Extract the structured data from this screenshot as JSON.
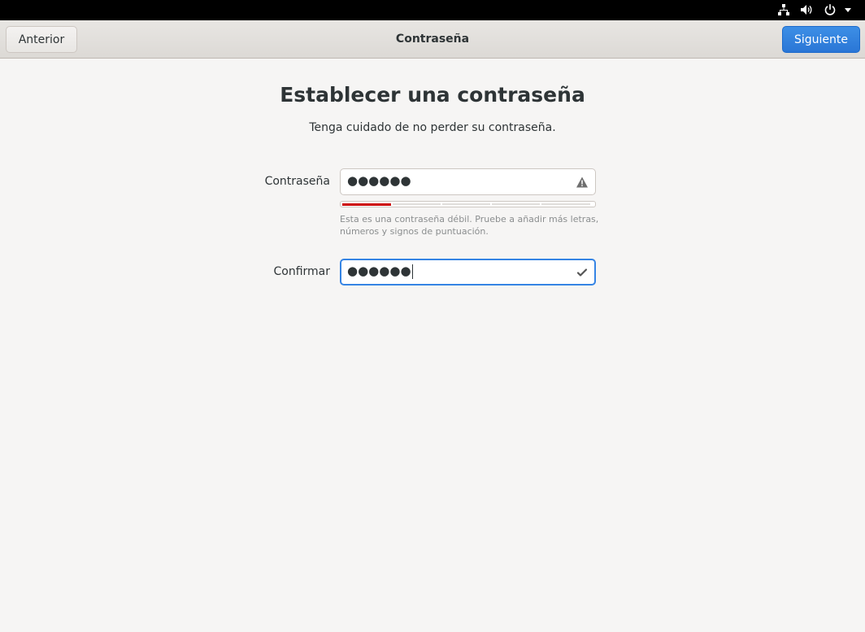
{
  "system_bar": {
    "icons": [
      "network-icon",
      "volume-icon",
      "power-icon",
      "menu-arrow-icon"
    ]
  },
  "header": {
    "back_label": "Anterior",
    "title": "Contraseña",
    "next_label": "Siguiente"
  },
  "page": {
    "title": "Establecer una contraseña",
    "subtitle": "Tenga cuidado de no perder su contraseña."
  },
  "password": {
    "label": "Contraseña",
    "value": "●●●●●●",
    "status_icon": "warning-icon",
    "strength": {
      "level": 1,
      "segments": 5
    },
    "hint": "Esta es una contraseña débil. Pruebe a añadir más letras, números y signos de puntuación."
  },
  "confirm": {
    "label": "Confirmar",
    "value": "●●●●●●",
    "status_icon": "check-icon"
  },
  "colors": {
    "accent": "#3584e4",
    "weak": "#cc0000",
    "background": "#f6f5f4"
  }
}
